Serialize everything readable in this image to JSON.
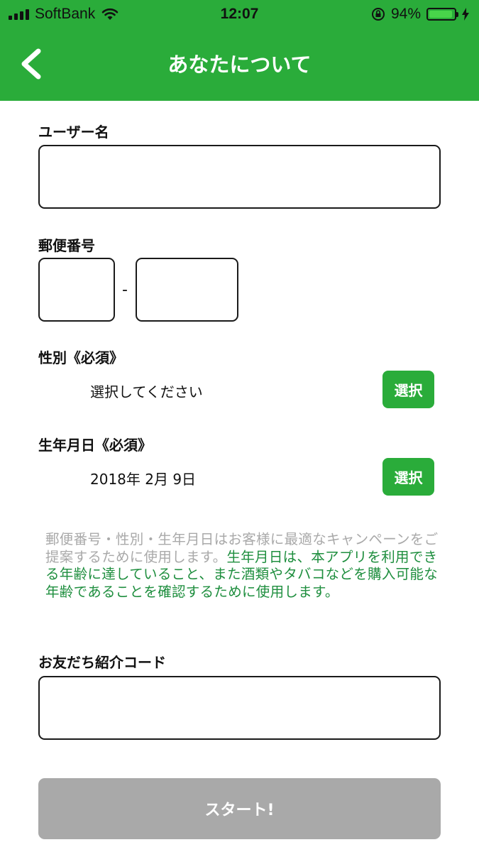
{
  "status_bar": {
    "carrier": "SoftBank",
    "time": "12:07",
    "battery_percent": "94%",
    "battery_level": 0.94
  },
  "nav": {
    "title": "あなたについて"
  },
  "form": {
    "username_label": "ユーザー名",
    "postal_label": "郵便番号",
    "postal_separator": "-",
    "gender_label": "性別《必須》",
    "gender_value": "選択してください",
    "gender_button": "選択",
    "birthday_label": "生年月日《必須》",
    "birthday_value": "2018年 2月 9日",
    "birthday_button": "選択",
    "referral_label": "お友だち紹介コード"
  },
  "note": {
    "gray_text": "郵便番号・性別・生年月日はお客様に最適なキャンペーンをご提案するために使用します。",
    "green_text": "生年月日は、本アプリを利用できる年齢に達していること、また酒類やタバコなどを購入可能な年齢であることを確認するために使用します。"
  },
  "start_button": "スタート!",
  "colors": {
    "brand_green": "#2aac3a",
    "note_green": "#1e8e3e",
    "disabled_gray": "#a9a9a9"
  }
}
